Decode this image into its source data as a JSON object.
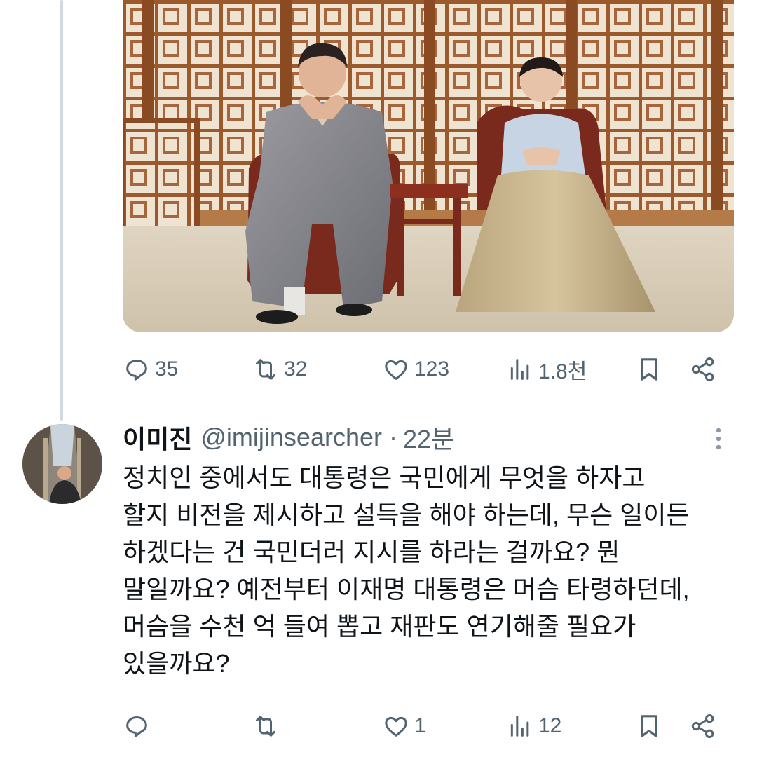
{
  "colors": {
    "text": "#0f1419",
    "secondary": "#536471",
    "thread_line": "#cfd9de"
  },
  "previous_tweet": {
    "media": {
      "kind": "photo",
      "zoom_icon": "zoom-icon"
    },
    "actions": {
      "reply": {
        "icon": "reply-icon",
        "count": "35"
      },
      "retweet": {
        "icon": "retweet-icon",
        "count": "32"
      },
      "like": {
        "icon": "heart-icon",
        "count": "123"
      },
      "views": {
        "icon": "views-icon",
        "count": "1.8천"
      },
      "bookmark": {
        "icon": "bookmark-icon"
      },
      "share": {
        "icon": "share-icon"
      }
    }
  },
  "reply_tweet": {
    "author": {
      "name": "이미진",
      "handle": "@imijinsearcher"
    },
    "separator": "·",
    "time": "22분",
    "more_icon": "more-dots-icon",
    "body_lines": [
      "정치인 중에서도 대통령은 국민에게 무엇을 하자고",
      "할지 비전을 제시하고 설득을 해야 하는데, 무슨 일이든",
      "하겠다는 건 국민더러 지시를 하라는 걸까요? 뭔",
      "말일까요? 예전부터 이재명 대통령은 머슴 타령하던데,",
      "머슴을 수천 억 들여 뽑고 재판도 연기해줄 필요가",
      "있을까요?"
    ],
    "actions": {
      "reply": {
        "icon": "reply-icon",
        "count": ""
      },
      "retweet": {
        "icon": "retweet-icon",
        "count": ""
      },
      "like": {
        "icon": "heart-icon",
        "count": "1"
      },
      "views": {
        "icon": "views-icon",
        "count": "12"
      },
      "bookmark": {
        "icon": "bookmark-icon"
      },
      "share": {
        "icon": "share-icon"
      }
    }
  }
}
